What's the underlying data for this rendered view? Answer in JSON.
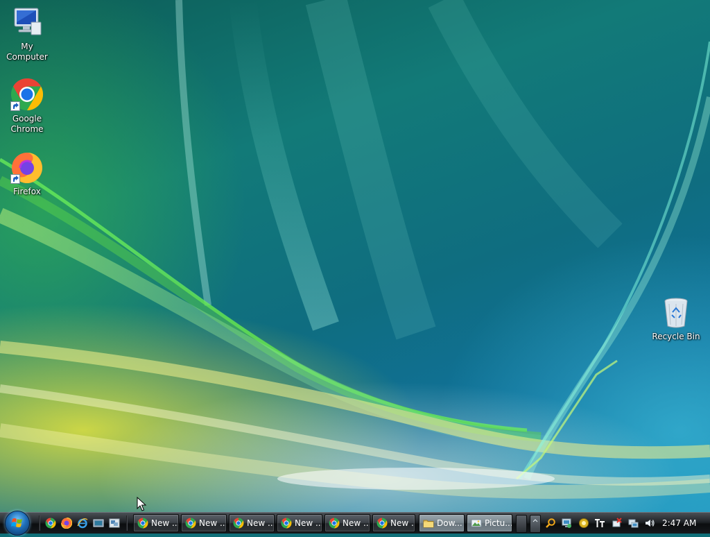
{
  "desktop": {
    "icons": [
      {
        "label": "My Computer",
        "icon": "computer-icon"
      },
      {
        "label": "Google Chrome",
        "icon": "chrome-icon"
      },
      {
        "label": "Firefox",
        "icon": "firefox-icon"
      },
      {
        "label": "Recycle Bin",
        "icon": "recycle-bin-icon"
      }
    ]
  },
  "taskbar": {
    "start_icon": "windows-logo-icon",
    "quick_launch": [
      "chrome-icon",
      "firefox-icon",
      "internet-explorer-icon",
      "show-desktop-icon",
      "switch-windows-icon"
    ],
    "buttons": [
      {
        "label": "New ...",
        "icon": "chrome-icon"
      },
      {
        "label": "New ...",
        "icon": "chrome-icon"
      },
      {
        "label": "New ...",
        "icon": "chrome-icon"
      },
      {
        "label": "New ...",
        "icon": "chrome-icon"
      },
      {
        "label": "New ...",
        "icon": "chrome-icon"
      },
      {
        "label": "New ...",
        "icon": "chrome-icon"
      },
      {
        "label": "Dow...",
        "icon": "folder-icon"
      },
      {
        "label": "Pictu...",
        "icon": "picture-viewer-icon"
      }
    ],
    "tray_icons": [
      "search-icon",
      "network-monitor-icon",
      "update-icon",
      "font-icon",
      "safely-remove-icon",
      "network-icon",
      "volume-icon"
    ],
    "clock": "2:47 AM"
  },
  "colors": {
    "taskbar_bg": "#1f2327",
    "accent_green": "#5ed64a",
    "accent_yellow": "#e6e43a"
  }
}
